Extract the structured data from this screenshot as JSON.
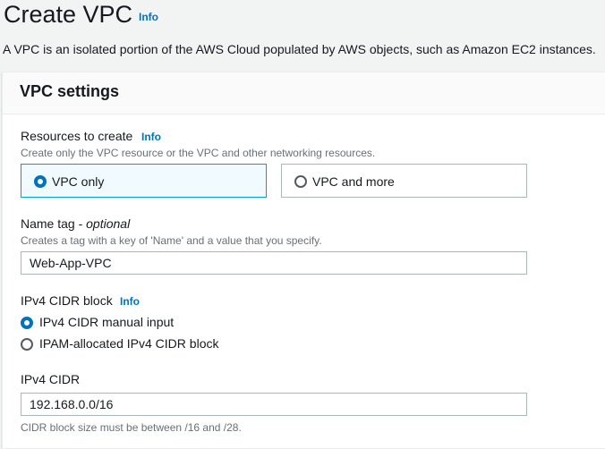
{
  "header": {
    "title": "Create VPC",
    "info": "Info",
    "description": "A VPC is an isolated portion of the AWS Cloud populated by AWS objects, such as Amazon EC2 instances."
  },
  "settings": {
    "title": "VPC settings",
    "resources": {
      "label": "Resources to create",
      "info": "Info",
      "description": "Create only the VPC resource or the VPC and other networking resources.",
      "options": [
        {
          "label": "VPC only",
          "selected": true
        },
        {
          "label": "VPC and more",
          "selected": false
        }
      ]
    },
    "name_tag": {
      "label": "Name tag - ",
      "optional": "optional",
      "description": "Creates a tag with a key of 'Name' and a value that you specify.",
      "value": "Web-App-VPC"
    },
    "ipv4_block": {
      "label": "IPv4 CIDR block",
      "info": "Info",
      "options": [
        {
          "label": "IPv4 CIDR manual input",
          "selected": true
        },
        {
          "label": "IPAM-allocated IPv4 CIDR block",
          "selected": false
        }
      ]
    },
    "ipv4_cidr": {
      "label": "IPv4 CIDR",
      "value": "192.168.0.0/16",
      "hint": "CIDR block size must be between /16 and /28."
    }
  },
  "colors": {
    "accent": "#0073bb",
    "selected_border": "#00a1c9",
    "selected_bg": "#f1faff"
  }
}
